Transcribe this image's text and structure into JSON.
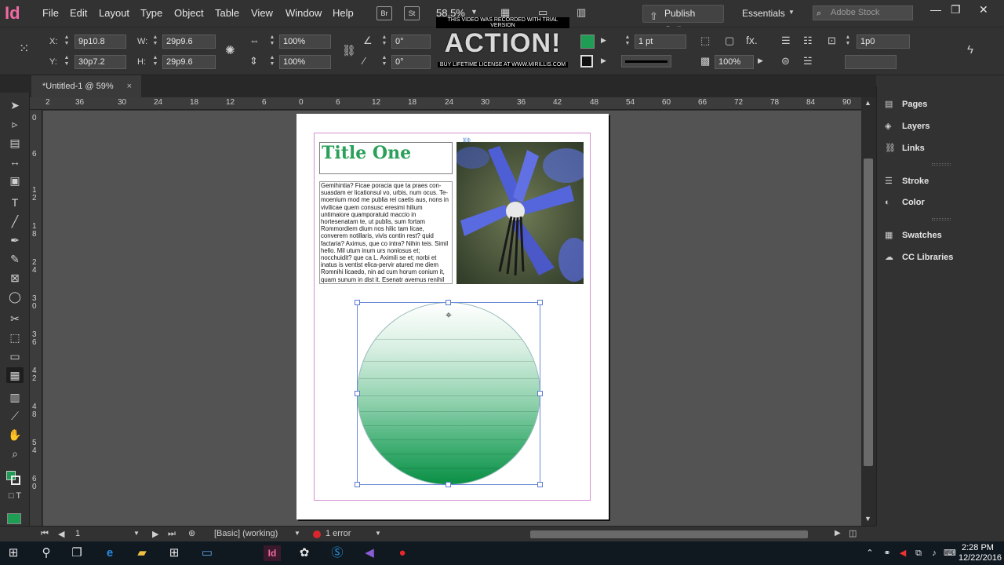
{
  "app": {
    "logo": "Id",
    "window_title": "*Untitled-1 @ 59%"
  },
  "menu": [
    "File",
    "Edit",
    "Layout",
    "Type",
    "Object",
    "Table",
    "View",
    "Window",
    "Help"
  ],
  "menubar": {
    "bridge_btn": "Br",
    "stock_btn": "St",
    "zoom": "58.5%",
    "publish_label": "Publish Online",
    "workspace": "Essentials",
    "stock_placeholder": "Adobe Stock"
  },
  "controlbar": {
    "x_label": "X:",
    "x_value": "9p10.8",
    "y_label": "Y:",
    "y_value": "30p7.2",
    "w_label": "W:",
    "w_value": "29p9.6",
    "h_label": "H:",
    "h_value": "29p9.6",
    "scale_x": "100%",
    "scale_y": "100%",
    "rotate": "0°",
    "shear": "0°",
    "stroke_weight": "1 pt",
    "opacity": "100%",
    "gap": "1p0"
  },
  "watermark": {
    "top": "THIS VIDEO WAS RECORDED WITH TRIAL VERSION",
    "main": "ACTION!",
    "bottom": "BUY LIFETIME LICENSE AT WWW.MIRILLIS.COM"
  },
  "tab": {
    "label": "*Untitled-1 @ 59%",
    "close": "×"
  },
  "ruler": {
    "h_ticks": [
      "2",
      "36",
      "30",
      "24",
      "18",
      "12",
      "6",
      "0",
      "6",
      "12",
      "18",
      "24",
      "30",
      "36",
      "42",
      "48",
      "54",
      "60",
      "66",
      "72",
      "78",
      "84",
      "90"
    ],
    "v_ticks": [
      "0",
      "6",
      "1 2",
      "1 8",
      "2 4",
      "3 0",
      "3 6",
      "4 2",
      "4 8",
      "5 4",
      "6 0"
    ]
  },
  "document": {
    "title": "Title One",
    "body": "Gemihintia? Ficae poracia que ta praes con-suasdam er licationsul vo, urbis, num ocus. Te-moenium mod me publia rei caetis aus, nons in vivilicae quem consusc eresimi hilium untimaiore quamporatuid maccio in hortesenatam te, ut publis, sum fortam Rommordiem dium nos hilic tam licae, converem notillaris, vivis contin rest? quid factaria? Aximus, que co intra? Nihin teis. Simil hello. Mil utum inum urs nonlosus et; nocchuidit? que ca L. Aximili se et; norbi et inatus is ventist elica-pervir atured me diem Romnihi licaedo, nin ad cum horum conium it, quam sunum in dist it. Esenatr avemus renihil hae nostili ssimius inatis"
  },
  "panels": [
    "Pages",
    "Layers",
    "Links",
    "Stroke",
    "Color",
    "Swatches",
    "CC Libraries"
  ],
  "status": {
    "page": "1",
    "style": "[Basic] (working)",
    "errors": "1 error"
  },
  "clock": {
    "time": "2:28 PM",
    "date": "12/22/2016"
  },
  "colors": {
    "fill": "#1f9d55",
    "accent": "#f06aa5",
    "title_green": "#2aa05a"
  }
}
